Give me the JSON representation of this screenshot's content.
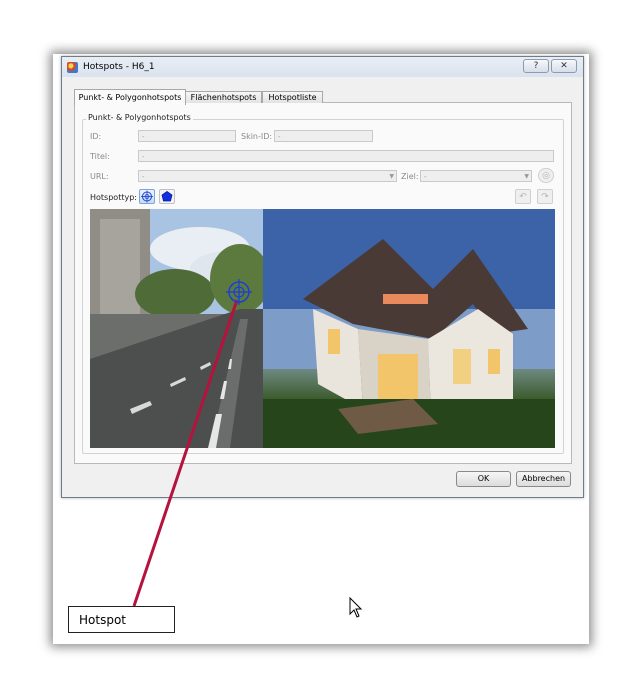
{
  "window": {
    "title": "Hotspots - H6_1",
    "help_label": "?",
    "close_label": "✕"
  },
  "tabs": [
    {
      "label": "Punkt- & Polygonhotspots",
      "active": true
    },
    {
      "label": "Flächenhotspots",
      "active": false
    },
    {
      "label": "Hotspotliste",
      "active": false
    }
  ],
  "group": {
    "title": "Punkt- & Polygonhotspots"
  },
  "form": {
    "id_label": "ID:",
    "id_value": "-",
    "skin_id_label": "Skin-ID:",
    "skin_id_value": "-",
    "title_label": "Titel:",
    "title_value": "-",
    "url_label": "URL:",
    "url_value": "-",
    "target_label": "Ziel:",
    "target_value": "-",
    "hotspot_type_label": "Hotspottyp:"
  },
  "buttons": {
    "ok": "OK",
    "cancel": "Abbrechen"
  },
  "callout": {
    "label": "Hotspot"
  },
  "colors": {
    "callout_line": "#b5123e",
    "hotspot_marker": "#1a3fd6",
    "polygon_tool": "#1030e0"
  },
  "icons": [
    "help-icon",
    "close-icon",
    "point-hotspot-icon",
    "polygon-hotspot-icon",
    "undo-icon",
    "redo-icon",
    "settings-icon",
    "dropdown-arrow-icon",
    "crosshair-icon",
    "mouse-cursor-icon"
  ]
}
